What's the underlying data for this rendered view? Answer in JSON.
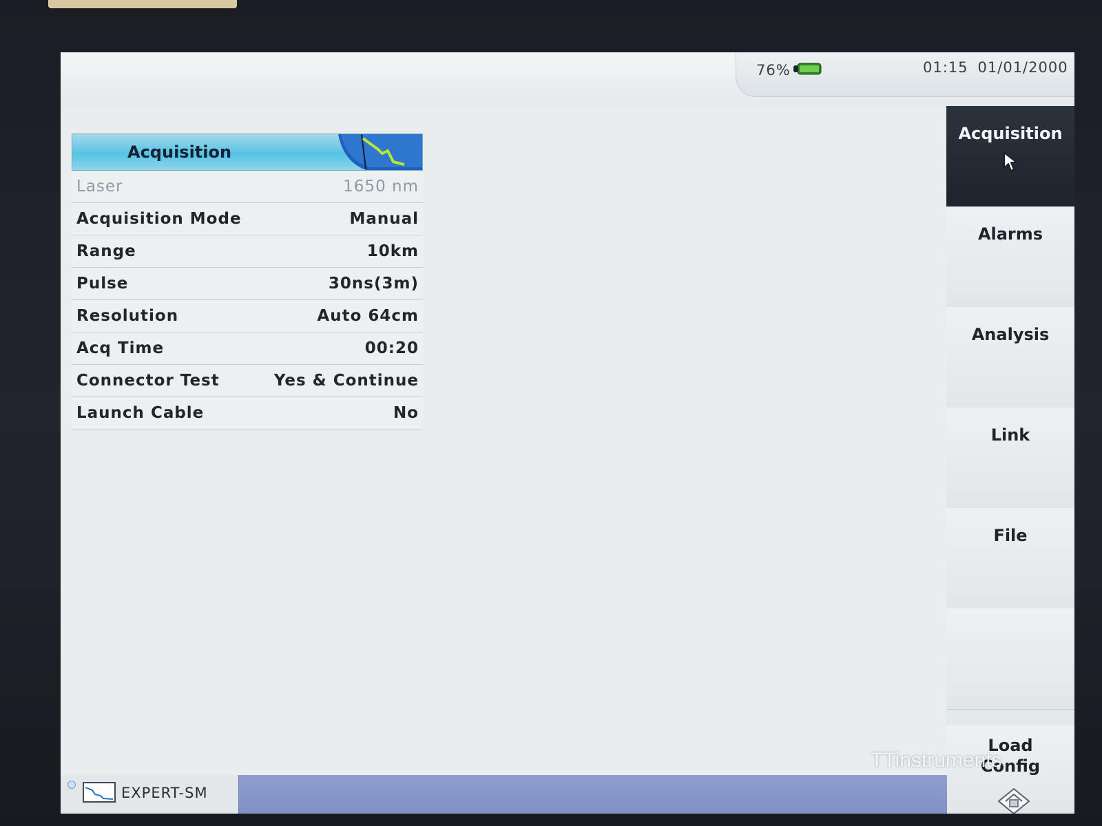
{
  "status": {
    "battery_percent": "76%",
    "time": "01:15",
    "date": "01/01/2000"
  },
  "panel": {
    "title": "Acquisition",
    "rows": [
      {
        "label": "Laser",
        "value": "1650 nm",
        "disabled": true
      },
      {
        "label": "Acquisition Mode",
        "value": "Manual"
      },
      {
        "label": "Range",
        "value": "10km"
      },
      {
        "label": "Pulse",
        "value": "30ns(3m)"
      },
      {
        "label": "Resolution",
        "value": "Auto 64cm"
      },
      {
        "label": "Acq Time",
        "value": "00:20"
      },
      {
        "label": "Connector Test",
        "value": "Yes & Continue"
      },
      {
        "label": "Launch Cable",
        "value": "No"
      }
    ]
  },
  "side_menu": {
    "items": [
      {
        "label": "Acquisition",
        "active": true
      },
      {
        "label": "Alarms"
      },
      {
        "label": "Analysis"
      },
      {
        "label": "Link"
      },
      {
        "label": "File"
      },
      {
        "label": ""
      }
    ],
    "load_config_label": "Load Config"
  },
  "bottom": {
    "mode_label": "EXPERT-SM"
  },
  "watermark": "TTinstruments",
  "colors": {
    "accent": "#56c3e6",
    "active_menu": "#1d242d",
    "progress_bar": "#8e9ecf"
  }
}
